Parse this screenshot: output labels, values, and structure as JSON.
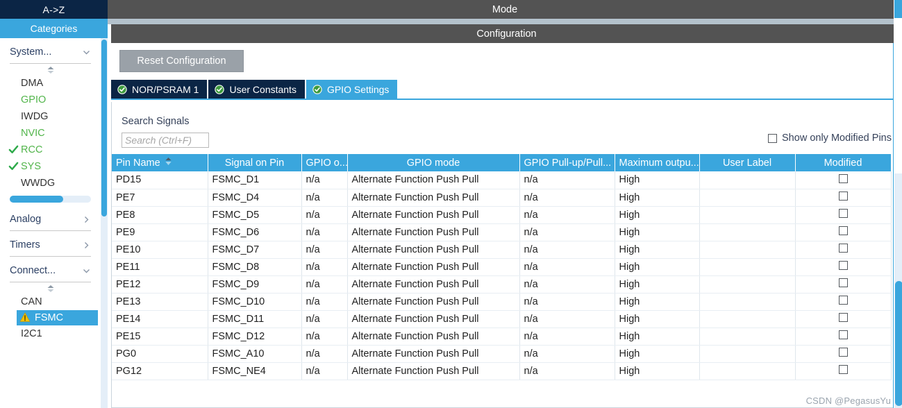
{
  "sidebar": {
    "az_label": "A->Z",
    "categories_label": "Categories",
    "groups": [
      {
        "label": "System...",
        "chevron": "chevron-down-icon",
        "expanded": true,
        "items": [
          {
            "label": "DMA",
            "state": "normal",
            "checked": false
          },
          {
            "label": "GPIO",
            "state": "green",
            "checked": false
          },
          {
            "label": "IWDG",
            "state": "normal",
            "checked": false
          },
          {
            "label": "NVIC",
            "state": "green",
            "checked": false
          },
          {
            "label": "RCC",
            "state": "green",
            "checked": true
          },
          {
            "label": "SYS",
            "state": "green",
            "checked": true
          },
          {
            "label": "WWDG",
            "state": "normal",
            "checked": false
          }
        ]
      },
      {
        "label": "Analog",
        "chevron": "chevron-right-icon",
        "expanded": false,
        "items": []
      },
      {
        "label": "Timers",
        "chevron": "chevron-right-icon",
        "expanded": false,
        "items": []
      },
      {
        "label": "Connect...",
        "chevron": "chevron-down-icon",
        "expanded": true,
        "items": [
          {
            "label": "CAN",
            "state": "normal",
            "checked": false
          },
          {
            "label": "FSMC",
            "state": "selected",
            "checked": false,
            "warning": true
          },
          {
            "label": "I2C1",
            "state": "normal",
            "checked": false
          }
        ]
      }
    ]
  },
  "header": {
    "mode_label": "Mode",
    "configuration_label": "Configuration"
  },
  "toolbar": {
    "reset_label": "Reset Configuration"
  },
  "tabs": [
    {
      "label": "NOR/PSRAM 1",
      "icon": "green-check-icon",
      "active": false
    },
    {
      "label": "User Constants",
      "icon": "green-check-icon",
      "active": false
    },
    {
      "label": "GPIO Settings",
      "icon": "green-check-icon",
      "active": true
    }
  ],
  "search": {
    "label": "Search Signals",
    "placeholder": "Search (Ctrl+F)",
    "value": ""
  },
  "filter": {
    "modified_label": "Show only Modified Pins",
    "modified_checked": false
  },
  "table": {
    "columns": [
      "Pin Name",
      "Signal on Pin",
      "GPIO o...",
      "GPIO mode",
      "GPIO Pull-up/Pull...",
      "Maximum outpu...",
      "User Label",
      "Modified"
    ],
    "sort_column": "Pin Name",
    "sort_icon": "sort-updown-icon",
    "rows": [
      {
        "pin": "PD15",
        "signal": "FSMC_D1",
        "gpio_o": "n/a",
        "mode": "Alternate Function Push Pull",
        "pull": "n/a",
        "speed": "High",
        "user_label": "",
        "modified": false
      },
      {
        "pin": "PE7",
        "signal": "FSMC_D4",
        "gpio_o": "n/a",
        "mode": "Alternate Function Push Pull",
        "pull": "n/a",
        "speed": "High",
        "user_label": "",
        "modified": false
      },
      {
        "pin": "PE8",
        "signal": "FSMC_D5",
        "gpio_o": "n/a",
        "mode": "Alternate Function Push Pull",
        "pull": "n/a",
        "speed": "High",
        "user_label": "",
        "modified": false
      },
      {
        "pin": "PE9",
        "signal": "FSMC_D6",
        "gpio_o": "n/a",
        "mode": "Alternate Function Push Pull",
        "pull": "n/a",
        "speed": "High",
        "user_label": "",
        "modified": false
      },
      {
        "pin": "PE10",
        "signal": "FSMC_D7",
        "gpio_o": "n/a",
        "mode": "Alternate Function Push Pull",
        "pull": "n/a",
        "speed": "High",
        "user_label": "",
        "modified": false
      },
      {
        "pin": "PE11",
        "signal": "FSMC_D8",
        "gpio_o": "n/a",
        "mode": "Alternate Function Push Pull",
        "pull": "n/a",
        "speed": "High",
        "user_label": "",
        "modified": false
      },
      {
        "pin": "PE12",
        "signal": "FSMC_D9",
        "gpio_o": "n/a",
        "mode": "Alternate Function Push Pull",
        "pull": "n/a",
        "speed": "High",
        "user_label": "",
        "modified": false
      },
      {
        "pin": "PE13",
        "signal": "FSMC_D10",
        "gpio_o": "n/a",
        "mode": "Alternate Function Push Pull",
        "pull": "n/a",
        "speed": "High",
        "user_label": "",
        "modified": false
      },
      {
        "pin": "PE14",
        "signal": "FSMC_D11",
        "gpio_o": "n/a",
        "mode": "Alternate Function Push Pull",
        "pull": "n/a",
        "speed": "High",
        "user_label": "",
        "modified": false
      },
      {
        "pin": "PE15",
        "signal": "FSMC_D12",
        "gpio_o": "n/a",
        "mode": "Alternate Function Push Pull",
        "pull": "n/a",
        "speed": "High",
        "user_label": "",
        "modified": false
      },
      {
        "pin": "PG0",
        "signal": "FSMC_A10",
        "gpio_o": "n/a",
        "mode": "Alternate Function Push Pull",
        "pull": "n/a",
        "speed": "High",
        "user_label": "",
        "modified": false
      },
      {
        "pin": "PG12",
        "signal": "FSMC_NE4",
        "gpio_o": "n/a",
        "mode": "Alternate Function Push Pull",
        "pull": "n/a",
        "speed": "High",
        "user_label": "",
        "modified": false
      }
    ]
  },
  "watermark": "CSDN @PegasusYu",
  "colors": {
    "accent": "#3aa6dd",
    "navy": "#0b2545",
    "band": "#535353",
    "green": "#52b54b",
    "warning": "#f2c200"
  }
}
